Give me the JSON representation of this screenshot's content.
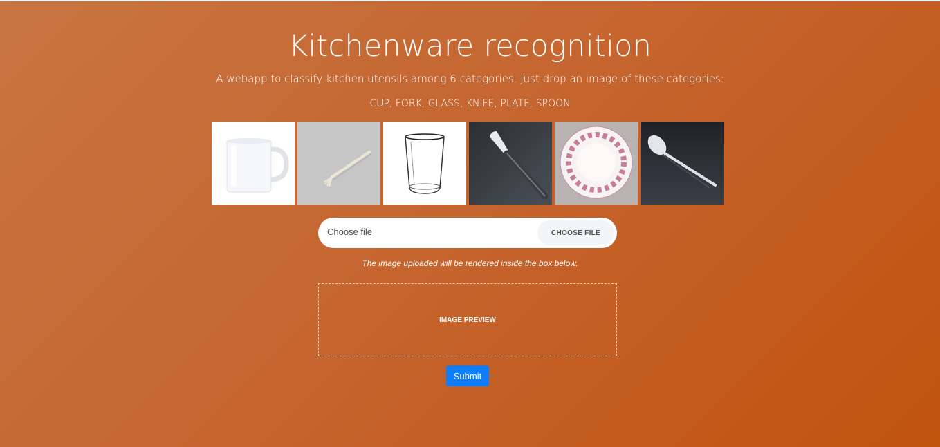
{
  "header": {
    "title": "Kitchenware recognition",
    "subtitle": "A webapp to classify kitchen utensils among 6 categories. Just drop an image of these categories:",
    "categories_text": "CUP, FORK, GLASS, KNIFE, PLATE, SPOON"
  },
  "examples": [
    {
      "icon": "cup-image"
    },
    {
      "icon": "fork-image"
    },
    {
      "icon": "glass-image"
    },
    {
      "icon": "knife-image"
    },
    {
      "icon": "plate-image"
    },
    {
      "icon": "spoon-image"
    }
  ],
  "upload": {
    "placeholder": "Choose file",
    "button_label": "CHOOSE FILE",
    "hint": "The image uploaded will be rendered inside the box below."
  },
  "preview": {
    "label": "IMAGE PREVIEW"
  },
  "submit": {
    "label": "Submit"
  },
  "colors": {
    "background_start": "#c87543",
    "background_end": "#c0530e",
    "submit_button": "#0d7dfa"
  }
}
